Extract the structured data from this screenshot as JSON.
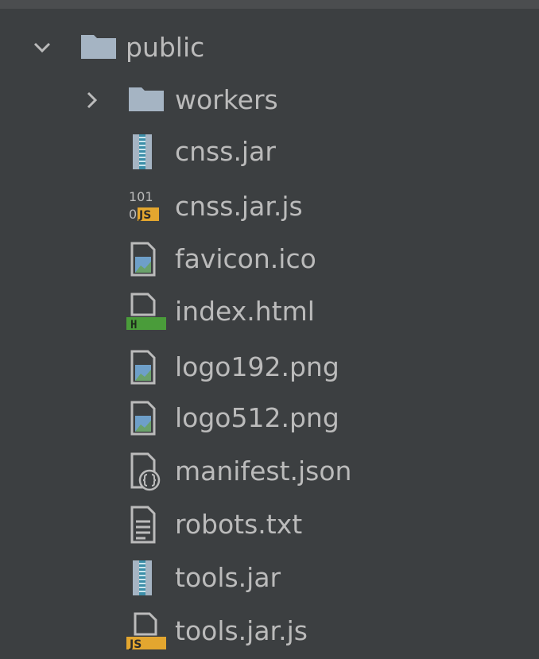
{
  "tree": {
    "root": {
      "name": "public",
      "expanded": true,
      "arrow_icon": "chevron-down-icon",
      "icon": "folder-icon"
    },
    "children": [
      {
        "name": "workers",
        "type": "folder",
        "icon": "folder-icon",
        "arrow_icon": "chevron-right-icon"
      },
      {
        "name": "cnss.jar",
        "type": "archive",
        "icon": "jar-archive-icon"
      },
      {
        "name": "cnss.jar.js",
        "type": "javascript",
        "icon": "js-binary-icon",
        "icon_text_top": "101",
        "icon_text_bottom": "0",
        "icon_badge": "JS"
      },
      {
        "name": "favicon.ico",
        "type": "image",
        "icon": "image-file-icon"
      },
      {
        "name": "index.html",
        "type": "html",
        "icon": "html-file-icon",
        "icon_badge": "H"
      },
      {
        "name": "logo192.png",
        "type": "image",
        "icon": "image-file-icon"
      },
      {
        "name": "logo512.png",
        "type": "image",
        "icon": "image-file-icon"
      },
      {
        "name": "manifest.json",
        "type": "json",
        "icon": "json-file-icon"
      },
      {
        "name": "robots.txt",
        "type": "text",
        "icon": "text-file-icon"
      },
      {
        "name": "tools.jar",
        "type": "archive",
        "icon": "jar-archive-icon"
      },
      {
        "name": "tools.jar.js",
        "type": "javascript",
        "icon": "js-file-icon",
        "icon_badge": "JS"
      }
    ]
  },
  "colors": {
    "background": "#3c3f41",
    "text": "#bbbbbb",
    "folder": "#a5b4c3",
    "html_badge": "#4a9c3a",
    "js_badge": "#e3a62f",
    "image_green": "#6aa16a",
    "image_blue": "#6e9fc9"
  }
}
